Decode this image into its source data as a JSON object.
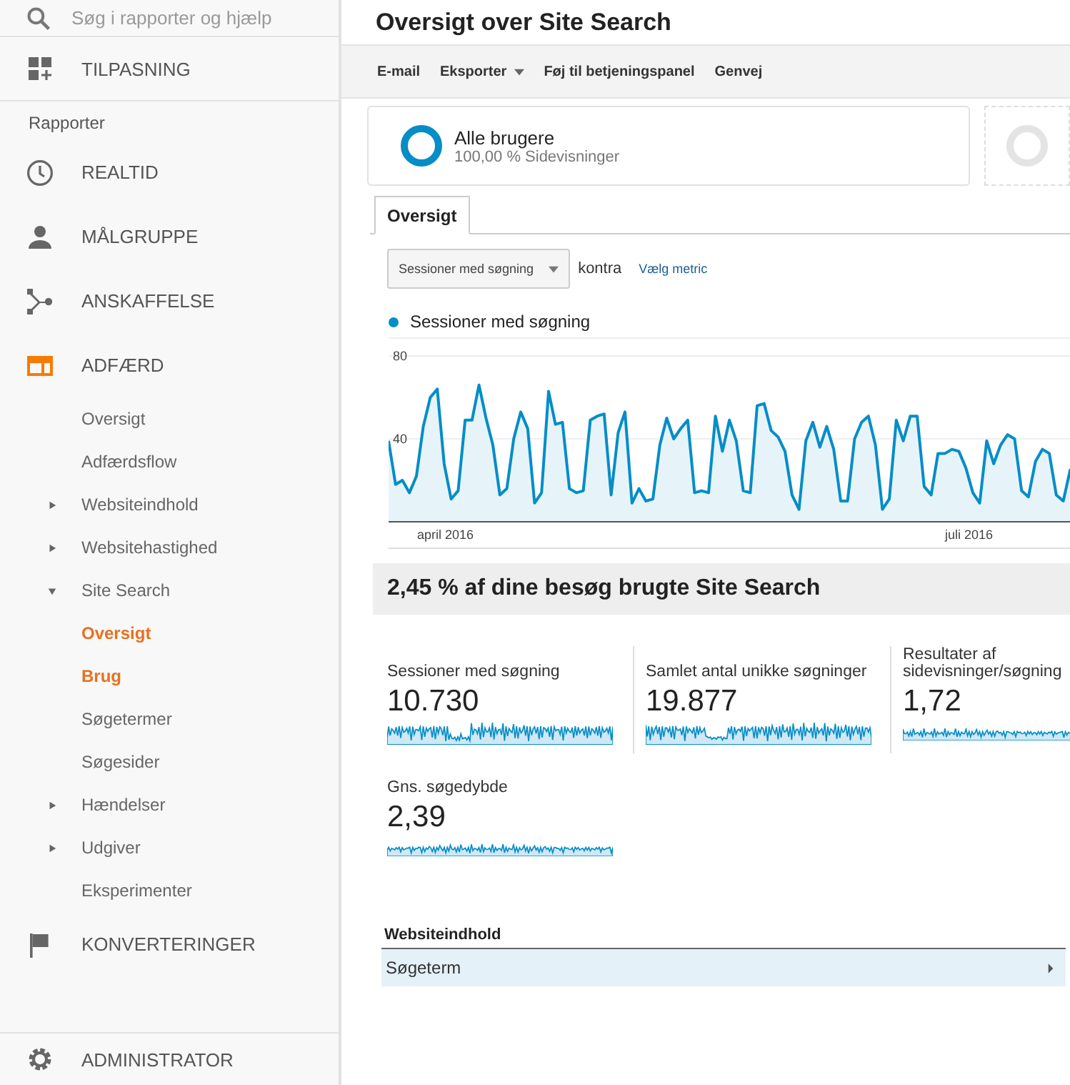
{
  "sidebar": {
    "search": {
      "placeholder": "Søg i rapporter og hjælp"
    },
    "customization": {
      "label": "TILPASNING"
    },
    "section_label": "Rapporter",
    "items": [
      {
        "label": "REALTID",
        "active": false
      },
      {
        "label": "MÅLGRUPPE",
        "active": false
      },
      {
        "label": "ANSKAFFELSE",
        "active": false
      },
      {
        "label": "ADFÆRD",
        "active": true,
        "children": [
          {
            "label": "Oversigt",
            "selected": false
          },
          {
            "label": "Adfærdsflow",
            "selected": false
          },
          {
            "label": "Websiteindhold",
            "selected": false,
            "expanded": false
          },
          {
            "label": "Websitehastighed",
            "selected": false,
            "expanded": false
          },
          {
            "label": "Site Search",
            "selected": false,
            "expanded": true,
            "children": [
              {
                "label": "Oversigt",
                "selected": true
              },
              {
                "label": "Brug",
                "selected": true
              },
              {
                "label": "Søgetermer",
                "selected": false
              },
              {
                "label": "Søgesider",
                "selected": false
              }
            ]
          },
          {
            "label": "Hændelser",
            "selected": false,
            "expanded": false
          },
          {
            "label": "Udgiver",
            "selected": false,
            "expanded": false
          },
          {
            "label": "Eksperimenter",
            "selected": false
          }
        ]
      },
      {
        "label": "KONVERTERINGER",
        "active": false
      }
    ],
    "admin": {
      "label": "ADMINISTRATOR"
    }
  },
  "page_title": "Oversigt over Site Search",
  "toolbar": [
    {
      "label": "E-mail",
      "kind": "plain"
    },
    {
      "label": "Eksporter",
      "kind": "menu"
    },
    {
      "label": "Føj til betjeningspanel",
      "kind": "plain"
    },
    {
      "label": "Genvej",
      "kind": "plain"
    }
  ],
  "segment": {
    "name": "Alle brugere",
    "detail": "100,00 % Sidevisninger"
  },
  "tabs": [
    {
      "label": "Oversigt",
      "selected": true
    }
  ],
  "metric_selector": {
    "value": "Sessioner med søgning",
    "versus": "kontra",
    "link": "Vælg metric"
  },
  "chart": {
    "x_axis_labels": [
      "april 2016",
      "juli 2016"
    ],
    "chart_data": {
      "type": "area",
      "ylim": [
        0,
        80
      ],
      "yticks": [
        40,
        80
      ],
      "series": [
        {
          "name": "Sessioner med søgning",
          "color": "#058dc7",
          "values": [
            39,
            18,
            20,
            14,
            22,
            46,
            60,
            64,
            28,
            11,
            15,
            49,
            49,
            66,
            50,
            37,
            13,
            16,
            40,
            53,
            45,
            9,
            14,
            63,
            47,
            48,
            16,
            14,
            15,
            49,
            51,
            52,
            13,
            43,
            53,
            9,
            16,
            10,
            11,
            37,
            50,
            40,
            45,
            49,
            14,
            15,
            14,
            51,
            34,
            49,
            39,
            15,
            14,
            56,
            57,
            44,
            41,
            34,
            13,
            6,
            39,
            48,
            36,
            46,
            35,
            10,
            10,
            40,
            48,
            51,
            37,
            6,
            11,
            49,
            39,
            51,
            51,
            17,
            13,
            33,
            33,
            35,
            34,
            26,
            14,
            9,
            39,
            28,
            37,
            42,
            40,
            15,
            12,
            29,
            35,
            33,
            13,
            10,
            25,
            25
          ]
        }
      ]
    }
  },
  "summary": "2,45 % af dine besøg brugte Site Search",
  "metrics": [
    {
      "label": "Sessioner med søgning",
      "value": "10.730"
    },
    {
      "label": "Samlet antal unikke søgninger",
      "value": "19.877"
    },
    {
      "label": "Resultater af sidevisninger/søgning",
      "value": "1,72"
    },
    {
      "label": "Gns. søgedybde",
      "value": "2,39"
    }
  ],
  "table": {
    "title": "Websiteindhold",
    "rows": [
      {
        "label": "Søgeterm",
        "selected": true
      }
    ]
  }
}
